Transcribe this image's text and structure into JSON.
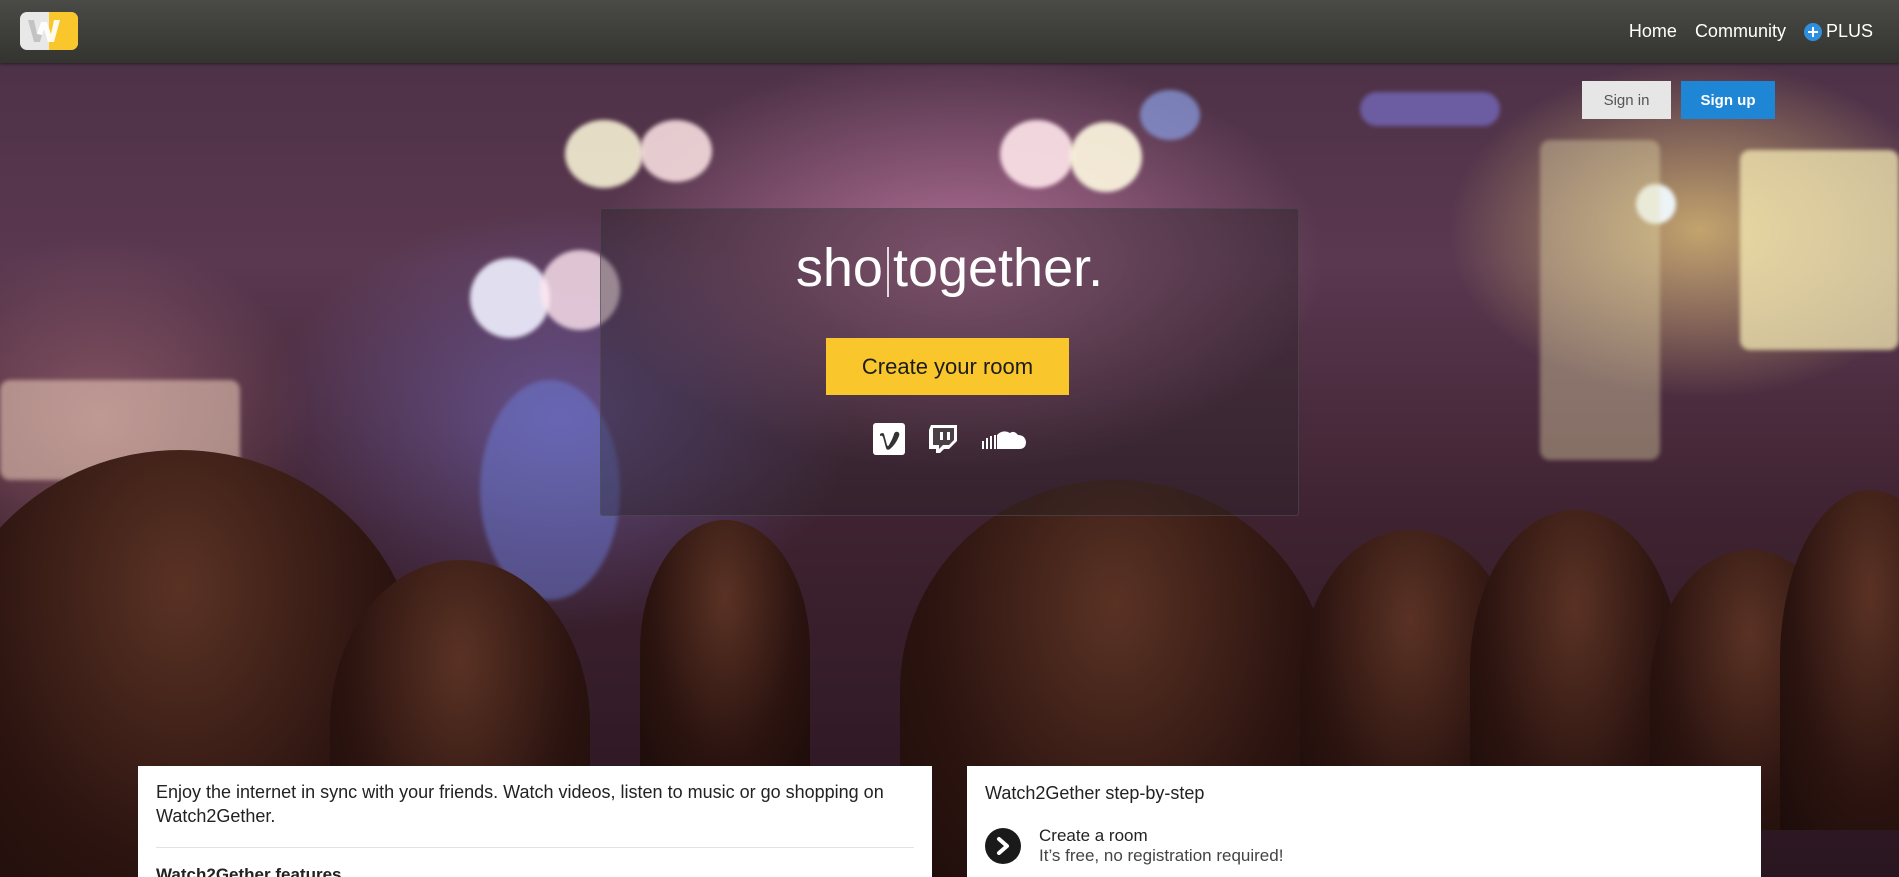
{
  "nav": {
    "items": [
      {
        "label": "Home"
      },
      {
        "label": "Community"
      },
      {
        "label": "PLUS"
      }
    ]
  },
  "auth": {
    "signin_label": "Sign in",
    "signup_label": "Sign up"
  },
  "hero": {
    "typed_text": "sho",
    "tagline_suffix": "together.",
    "create_room_label": "Create your room",
    "providers": [
      "vimeo-icon",
      "twitch-icon",
      "soundcloud-icon"
    ]
  },
  "intro": {
    "text": "Enjoy the internet in sync with your friends. Watch videos, listen to music or go shopping on Watch2Gether.",
    "features_heading": "Watch2Gether features"
  },
  "steps": {
    "heading": "Watch2Gether step-by-step",
    "items": [
      {
        "title": "Create a room",
        "description": "It’s free, no registration required!"
      }
    ]
  },
  "colors": {
    "accent_yellow": "#f9c62c",
    "signup_blue": "#1f86d6",
    "plus_blue": "#2e8fde",
    "topbar": "#3d3d39"
  }
}
